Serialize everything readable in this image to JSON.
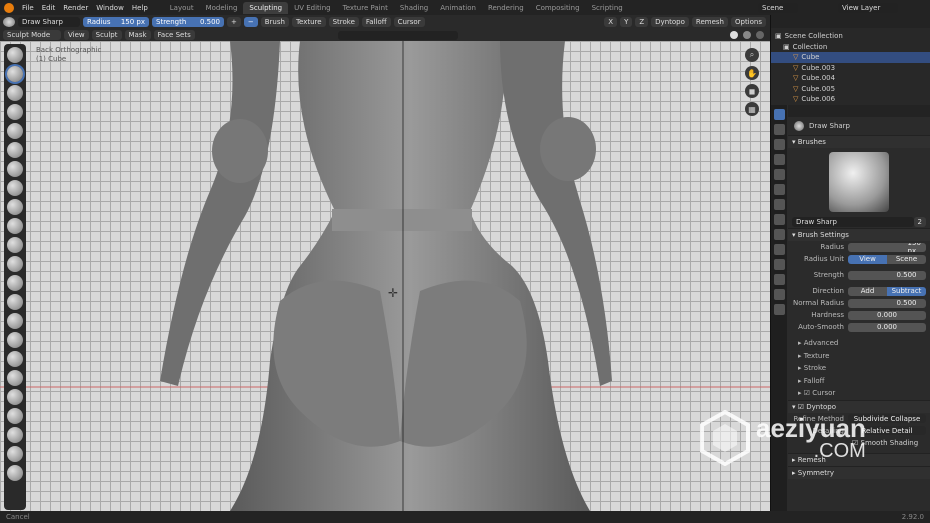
{
  "topbar": {
    "menus": [
      "File",
      "Edit",
      "Render",
      "Window",
      "Help"
    ],
    "workspaces": [
      "Layout",
      "Modeling",
      "Sculpting",
      "UV Editing",
      "Texture Paint",
      "Shading",
      "Animation",
      "Rendering",
      "Compositing",
      "Scripting"
    ],
    "active_workspace": "Sculpting",
    "scene": "Scene",
    "view_layer": "View Layer"
  },
  "tool_header": {
    "brush_name": "Draw Sharp",
    "radius_label": "Radius",
    "radius_value": "150 px",
    "strength_label": "Strength",
    "strength_value": "0.500",
    "plus": "+",
    "minus": "−",
    "menus": [
      "Brush",
      "Texture",
      "Stroke",
      "Falloff",
      "Cursor"
    ],
    "axes": [
      "X",
      "Y",
      "Z"
    ],
    "dyntopo": "Dyntopo",
    "remesh": "Remesh",
    "options": "Options"
  },
  "mode_header": {
    "mode": "Sculpt Mode",
    "menus": [
      "View",
      "Sculpt",
      "Mask",
      "Face Sets"
    ]
  },
  "viewport": {
    "view_label": "Back Orthographic",
    "object_label": "(1) Cube"
  },
  "outliner": {
    "title": "Scene Collection",
    "collection": "Collection",
    "items": [
      "Cube",
      "Cube.003",
      "Cube.004",
      "Cube.005",
      "Cube.006"
    ],
    "selected": "Cube"
  },
  "properties": {
    "tool_name": "Draw Sharp",
    "brushes_title": "Brushes",
    "brush_name": "Draw Sharp",
    "brush_users": "2",
    "brush_settings_title": "Brush Settings",
    "radius_label": "Radius",
    "radius_value": "150 px",
    "radius_unit_label": "Radius Unit",
    "radius_unit_options": [
      "View",
      "Scene"
    ],
    "strength_label": "Strength",
    "strength_value": "0.500",
    "strength_fill": 0.5,
    "direction_label": "Direction",
    "direction_options": [
      "Add",
      "Subtract"
    ],
    "normal_radius_label": "Normal Radius",
    "normal_radius_value": "0.500",
    "normal_radius_fill": 0.5,
    "hardness_label": "Hardness",
    "hardness_value": "0.000",
    "auto_smooth_label": "Auto-Smooth",
    "auto_smooth_value": "0.000",
    "subpanels": [
      "Advanced",
      "Texture",
      "Stroke",
      "Falloff",
      "Cursor"
    ],
    "dyntopo_label": "Dyntopo",
    "refine_label": "Refine Method",
    "refine_value": "Subdivide Collapse",
    "detailing_label": "Detailing",
    "detailing_value": "Relative Detail",
    "smooth_shading": "Smooth Shading",
    "remesh_label": "Remesh",
    "symmetry_label": "Symmetry"
  },
  "watermark": {
    "text": "aeziyuan",
    "sub": ".COM"
  },
  "status": {
    "left": "Cancel",
    "version": "2.92.0"
  }
}
